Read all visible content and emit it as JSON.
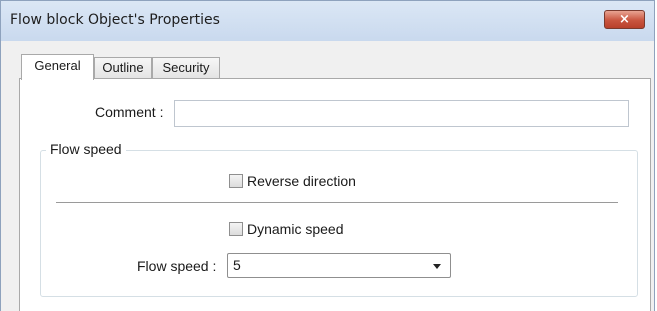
{
  "window": {
    "title": "Flow block Object's Properties",
    "close_label": "×"
  },
  "tabs": [
    {
      "label": "General",
      "active": true
    },
    {
      "label": "Outline",
      "active": false
    },
    {
      "label": "Security",
      "active": false
    }
  ],
  "general": {
    "comment_label": "Comment :",
    "comment_value": "",
    "group_title": "Flow speed",
    "reverse_direction": {
      "label": "Reverse direction",
      "checked": false
    },
    "dynamic_speed": {
      "label": "Dynamic speed",
      "checked": false
    },
    "flow_speed_label": "Flow speed :",
    "flow_speed_value": "5"
  },
  "colors": {
    "titlebar": "#c9d9ee",
    "close_button": "#c9553f",
    "panel": "#ffffff"
  }
}
